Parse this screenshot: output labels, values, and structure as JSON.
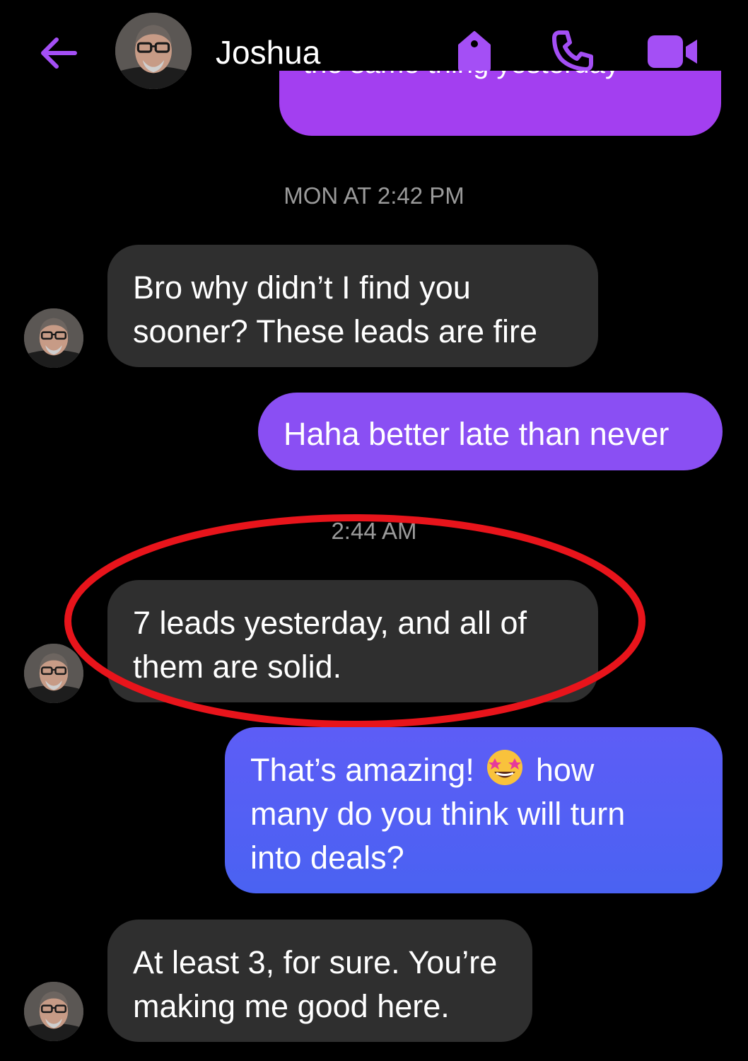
{
  "header": {
    "contact_name": "Joshua",
    "accent_color": "#a44ff5",
    "icons": [
      "back-arrow-icon",
      "tag-icon",
      "phone-icon",
      "video-camera-icon"
    ]
  },
  "messages": {
    "top_partial": {
      "text": "the same thing yesterday",
      "direction": "outgoing"
    },
    "timestamp_1": "MON AT 2:42 PM",
    "msg_1": {
      "direction": "incoming",
      "lines": [
        "Bro why didn’t I find you",
        "sooner? These leads are fire"
      ]
    },
    "msg_2": {
      "direction": "outgoing",
      "text": "Haha better late than never"
    },
    "timestamp_2": "2:44 AM",
    "msg_3": {
      "direction": "incoming",
      "highlighted": true,
      "lines": [
        "7 leads yesterday, and all of",
        "them are solid."
      ]
    },
    "msg_4": {
      "direction": "outgoing",
      "line1_before_emoji": "That’s amazing!",
      "emoji": "star-struck-emoji",
      "line1_after_emoji": "how",
      "line2": "many do you think will turn",
      "line3": "into deals?"
    },
    "msg_5": {
      "direction": "incoming",
      "lines": [
        "At least 3, for sure. You’re",
        "making me good here."
      ]
    }
  },
  "colors": {
    "incoming_bubble": "#2f2f2f",
    "outgoing_purple": "#8a4ff3",
    "outgoing_blue": "#4f5ff5",
    "highlight_circle": "#e8141b"
  }
}
